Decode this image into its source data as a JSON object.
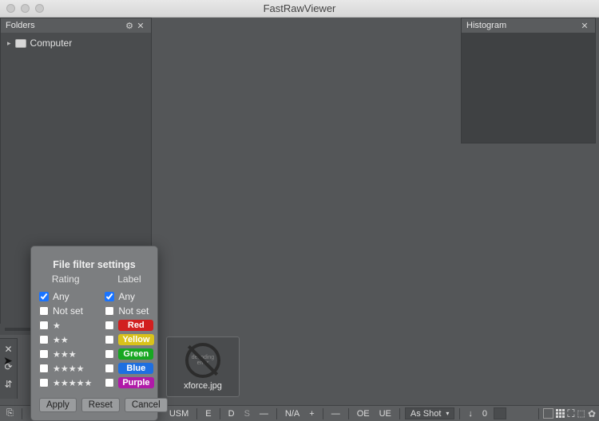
{
  "window": {
    "title": "FastRawViewer"
  },
  "folders": {
    "title": "Folders",
    "root_label": "Computer"
  },
  "histogram": {
    "title": "Histogram"
  },
  "thumbnail": {
    "error_text": "decoding error",
    "filename": "xforce.jpg"
  },
  "statusbar": {
    "usm": "USM",
    "e": "E",
    "d": "D",
    "s": "S",
    "dash": "—",
    "na": "N/A",
    "plus": "+",
    "minus": "—",
    "oe": "OE",
    "ue": "UE",
    "wb_mode": "As Shot",
    "wb_value": "0",
    "down_arrow": "↓"
  },
  "dialog": {
    "title": "File filter settings",
    "rating_header": "Rating",
    "label_header": "Label",
    "any": "Any",
    "not_set": "Not set",
    "stars": {
      "s1": "★",
      "s2": "★★",
      "s3": "★★★",
      "s4": "★★★★",
      "s5": "★★★★★"
    },
    "labels": {
      "red": {
        "text": "Red",
        "color": "#d11f1f"
      },
      "yellow": {
        "text": "Yellow",
        "color": "#d9c21a"
      },
      "green": {
        "text": "Green",
        "color": "#17a721"
      },
      "blue": {
        "text": "Blue",
        "color": "#1e6fe0"
      },
      "purple": {
        "text": "Purple",
        "color": "#b01aa8"
      }
    },
    "buttons": {
      "apply": "Apply",
      "reset": "Reset",
      "cancel": "Cancel"
    }
  }
}
